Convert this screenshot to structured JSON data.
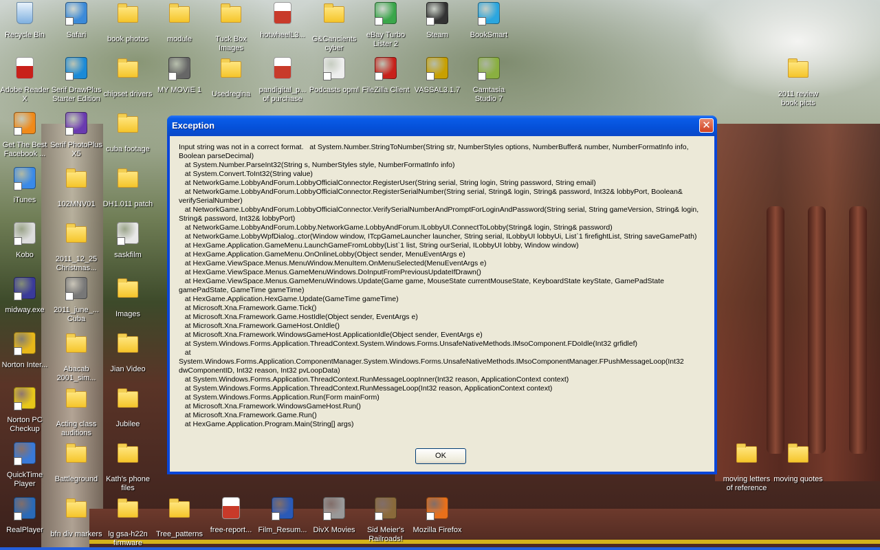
{
  "desktop": {
    "icons": [
      {
        "label": "Recycle Bin",
        "kind": "recycle",
        "color": "#7fb0e0"
      },
      {
        "label": "Safari",
        "kind": "app",
        "color": "#3b8ad9"
      },
      {
        "label": "book photos",
        "kind": "folder"
      },
      {
        "label": "module",
        "kind": "folder"
      },
      {
        "label": "Tuck Box Images",
        "kind": "folder"
      },
      {
        "label": "hotwheelL3...",
        "kind": "pdf",
        "color": "#c83a2a"
      },
      {
        "label": "G&Cancients cyber",
        "kind": "folder"
      },
      {
        "label": "eBay Turbo Lister 2",
        "kind": "app",
        "color": "#3aa64a"
      },
      {
        "label": "Steam",
        "kind": "app",
        "color": "#333333"
      },
      {
        "label": "BookSmart",
        "kind": "app",
        "color": "#2ba6df"
      },
      {
        "label": "Adobe Reader X",
        "kind": "pdf",
        "color": "#c8201a"
      },
      {
        "label": "Serif DrawPlus Starter Edition",
        "kind": "app",
        "color": "#1a8ad8"
      },
      {
        "label": "chipset drivers",
        "kind": "folder"
      },
      {
        "label": "MY MOVIE 1",
        "kind": "app",
        "color": "#666666"
      },
      {
        "label": "Usedregina",
        "kind": "folder"
      },
      {
        "label": "pandigital_p... of purchase",
        "kind": "pdf",
        "color": "#c83a2a"
      },
      {
        "label": "Podcasts opml",
        "kind": "app",
        "color": "#eeeeee"
      },
      {
        "label": "FileZilla Client",
        "kind": "app",
        "color": "#c8201a"
      },
      {
        "label": "VASSAL3.1.7",
        "kind": "app",
        "color": "#c8a000"
      },
      {
        "label": "Camtasia Studio 7",
        "kind": "app",
        "color": "#8ab040"
      },
      {
        "label": "2011 review book picts",
        "kind": "folder"
      },
      {
        "label": "Get The Best Facebook ...",
        "kind": "app",
        "color": "#f08a1a"
      },
      {
        "label": "Serif PhotoPlus X5",
        "kind": "app",
        "color": "#6a3ab0"
      },
      {
        "label": "cuba footage",
        "kind": "folder"
      },
      {
        "label": "iTunes",
        "kind": "app",
        "color": "#3a8ae8"
      },
      {
        "label": "102MNV01",
        "kind": "folder"
      },
      {
        "label": "DH1.011 patch",
        "kind": "folder"
      },
      {
        "label": "Kobo",
        "kind": "app",
        "color": "#dddddd"
      },
      {
        "label": "2011_12_25 Christmas...",
        "kind": "folder"
      },
      {
        "label": "saskfilm",
        "kind": "app",
        "color": "#e8e8e8"
      },
      {
        "label": "midway.exe",
        "kind": "app",
        "color": "#3a3a9a"
      },
      {
        "label": "2011_june_... Cuba",
        "kind": "app",
        "color": "#777777"
      },
      {
        "label": "Images",
        "kind": "folder"
      },
      {
        "label": "Norton Inter...",
        "kind": "app",
        "color": "#e8b81a"
      },
      {
        "label": "Abacab 2001_sim...",
        "kind": "folder"
      },
      {
        "label": "Jian Video",
        "kind": "folder"
      },
      {
        "label": "Norton PC Checkup",
        "kind": "app",
        "color": "#e8c81a"
      },
      {
        "label": "Acting class auditions",
        "kind": "folder"
      },
      {
        "label": "Jubilee",
        "kind": "folder"
      },
      {
        "label": "QuickTime Player",
        "kind": "app",
        "color": "#3a7ad8"
      },
      {
        "label": "Battleground",
        "kind": "folder"
      },
      {
        "label": "Kath's phone files",
        "kind": "folder"
      },
      {
        "label": "moving letters of reference",
        "kind": "folder"
      },
      {
        "label": "moving quotes",
        "kind": "folder"
      },
      {
        "label": "RealPlayer",
        "kind": "app",
        "color": "#2a6ab8"
      },
      {
        "label": "bfn div markers",
        "kind": "folder"
      },
      {
        "label": "lg gsa-h22n firmware",
        "kind": "folder"
      },
      {
        "label": "Tree_patterns",
        "kind": "folder"
      },
      {
        "label": "free-report...",
        "kind": "pdf",
        "color": "#c83a2a"
      },
      {
        "label": "Film_Resum...",
        "kind": "app",
        "color": "#2a5ab8"
      },
      {
        "label": "DivX Movies",
        "kind": "app",
        "color": "#999999"
      },
      {
        "label": "Sid Meier's Railroads!",
        "kind": "app",
        "color": "#8a6a3a"
      },
      {
        "label": "Mozilla Firefox",
        "kind": "app",
        "color": "#e8701a"
      }
    ]
  },
  "dialog": {
    "title": "Exception",
    "close_symbol": "✕",
    "message": "Input string was not in a correct format.   at System.Number.StringToNumber(String str, NumberStyles options, NumberBuffer& number, NumberFormatInfo info, Boolean parseDecimal)\n   at System.Number.ParseInt32(String s, NumberStyles style, NumberFormatInfo info)\n   at System.Convert.ToInt32(String value)\n   at NetworkGame.LobbyAndForum.LobbyOfficialConnector.RegisterUser(String serial, String login, String password, String email)\n   at NetworkGame.LobbyAndForum.LobbyOfficialConnector.RegisterSerialNumber(String serial, String& login, String& password, Int32& lobbyPort, Boolean& verifySerialNumber)\n   at NetworkGame.LobbyAndForum.LobbyOfficialConnector.VerifySerialNumberAndPromptForLoginAndPassword(String serial, String gameVersion, String& login, String& password, Int32& lobbyPort)\n   at NetworkGame.LobbyAndForum.Lobby.NetworkGame.LobbyAndForum.ILobbyUI.ConnectToLobby(String& login, String& password)\n   at NetworkGame.LobbyWpfDialog..ctor(Window window, ITcpGameLauncher launcher, String serial, ILobbyUI lobbyUi, List`1 firefightList, String saveGamePath)\n   at HexGame.Application.GameMenu.LaunchGameFromLobby(List`1 list, String ourSerial, ILobbyUI lobby, Window window)\n   at HexGame.Application.GameMenu.OnOnlineLobby(Object sender, MenuEventArgs e)\n   at HexGame.ViewSpace.Menus.MenuWindow.MenuItem.OnMenuSelected(MenuEventArgs e)\n   at HexGame.ViewSpace.Menus.GameMenuWindows.DoInputFromPreviousUpdateIfDrawn()\n   at HexGame.ViewSpace.Menus.GameMenuWindows.Update(Game game, MouseState currentMouseState, KeyboardState keyState, GamePadState gamePadState, GameTime gameTime)\n   at HexGame.Application.HexGame.Update(GameTime gameTime)\n   at Microsoft.Xna.Framework.Game.Tick()\n   at Microsoft.Xna.Framework.Game.HostIdle(Object sender, EventArgs e)\n   at Microsoft.Xna.Framework.GameHost.OnIdle()\n   at Microsoft.Xna.Framework.WindowsGameHost.ApplicationIdle(Object sender, EventArgs e)\n   at System.Windows.Forms.Application.ThreadContext.System.Windows.Forms.UnsafeNativeMethods.IMsoComponent.FDoIdle(Int32 grfidlef)\n   at\nSystem.Windows.Forms.Application.ComponentManager.System.Windows.Forms.UnsafeNativeMethods.IMsoComponentManager.FPushMessageLoop(Int32 dwComponentID, Int32 reason, Int32 pvLoopData)\n   at System.Windows.Forms.Application.ThreadContext.RunMessageLoopInner(Int32 reason, ApplicationContext context)\n   at System.Windows.Forms.Application.ThreadContext.RunMessageLoop(Int32 reason, ApplicationContext context)\n   at System.Windows.Forms.Application.Run(Form mainForm)\n   at Microsoft.Xna.Framework.WindowsGameHost.Run()\n   at Microsoft.Xna.Framework.Game.Run()\n   at HexGame.Application.Program.Main(String[] args)",
    "ok_label": "OK"
  }
}
